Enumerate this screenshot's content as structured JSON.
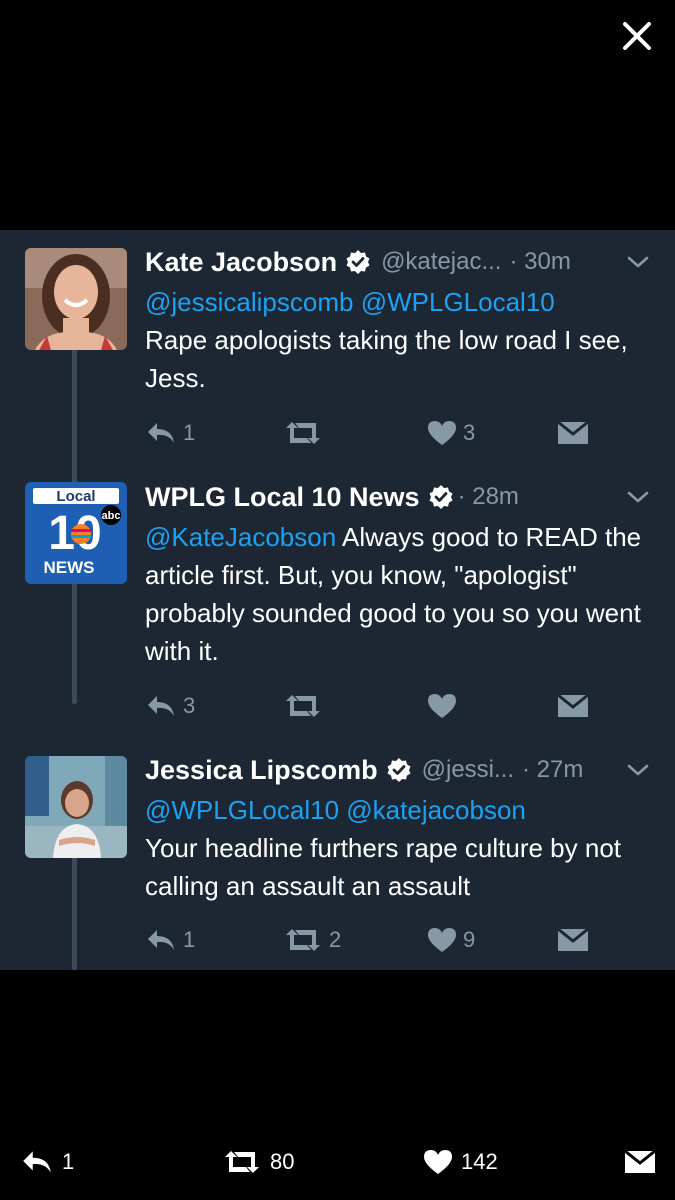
{
  "tweets": [
    {
      "name": "Kate Jacobson",
      "handle": "@katejac...",
      "time": "· 30m",
      "mentions": [
        "@jessicalipscomb",
        "@WPLGLocal10"
      ],
      "body": "Rape apologists taking the low road I see, Jess.",
      "reply_count": "1",
      "retweet_count": "",
      "like_count": "3"
    },
    {
      "name": "WPLG Local 10 News",
      "handle": "",
      "time": "· 28m",
      "mentions": [
        "@KateJacobson"
      ],
      "body": "Always good to READ the article first.  But, you know, \"apologist\" probably sounded good to you so you went with it.",
      "reply_count": "3",
      "retweet_count": "",
      "like_count": "",
      "avatar_logo": {
        "top": "Local",
        "number": "10",
        "network": "abc",
        "bottom": "NEWS"
      }
    },
    {
      "name": "Jessica Lipscomb",
      "handle": "@jessi...",
      "time": "· 27m",
      "mentions": [
        "@WPLGLocal10",
        "@katejacobson"
      ],
      "body": "Your headline furthers rape culture by not calling an assault an assault",
      "reply_count": "1",
      "retweet_count": "2",
      "like_count": "9"
    }
  ],
  "bottom_bar": {
    "reply_count": "1",
    "retweet_count": "80",
    "like_count": "142"
  },
  "icons": {
    "close": "close-icon",
    "verified": "verified-badge-icon",
    "caret": "chevron-down-icon",
    "reply": "reply-icon",
    "retweet": "retweet-icon",
    "like": "heart-icon",
    "dm": "envelope-icon"
  },
  "colors": {
    "panel": "#1c2733",
    "link": "#1da1f2",
    "muted": "#8899a6",
    "verified": "#ffffff",
    "background": "#000000"
  }
}
